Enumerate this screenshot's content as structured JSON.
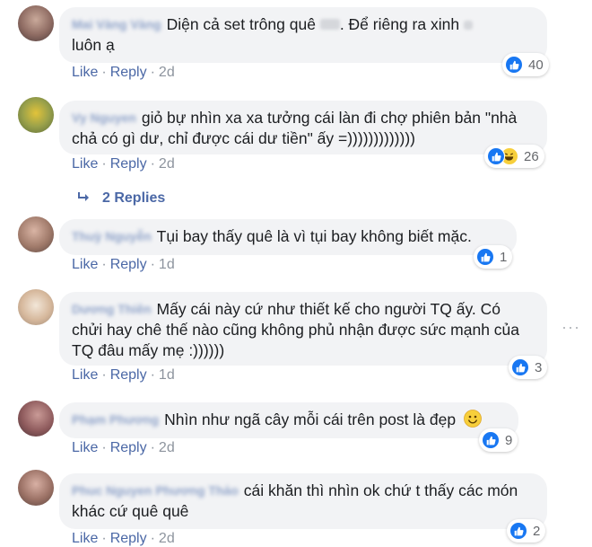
{
  "colors": {
    "accent": "#4b68a6",
    "like_blue": "#1877f2",
    "bubble_bg": "#f2f3f5"
  },
  "action_labels": {
    "like": "Like",
    "reply": "Reply",
    "separator": "·"
  },
  "comments": [
    {
      "author": "Mai Vàng Vàng",
      "text_a": "Diện cả set trông quê",
      "text_b": ". Để riêng ra xinh",
      "text_c": "luôn ạ",
      "time": "2d",
      "reactions": [
        "like"
      ],
      "reaction_count": "40"
    },
    {
      "author": "Vy Nguyen",
      "text": "giỏ bự nhìn xa xa tưởng cái làn đi chợ phiên bản \"nhà chả có gì dư, chỉ được cái dư tiền\" ấy =)))))))))))))",
      "time": "2d",
      "reactions": [
        "like",
        "haha"
      ],
      "reaction_count": "26",
      "replies_label": "2 Replies"
    },
    {
      "author": "Thuỳ Nguyễn",
      "text": "Tụi bay thấy quê là vì tụi bay không biết mặc.",
      "time": "1d",
      "reactions": [
        "like"
      ],
      "reaction_count": "1"
    },
    {
      "author": "Dương Thiên",
      "text": "Mấy cái này cứ như thiết kế cho người TQ ấy. Có chửi hay chê thế nào cũng không phủ nhận được sức mạnh của TQ đâu mấy mẹ :))))))",
      "time": "1d",
      "reactions": [
        "like"
      ],
      "reaction_count": "3",
      "more_icon": "···"
    },
    {
      "author": "Phạm Phương",
      "text": "Nhìn như ngã cây mỗi cái trên post là đẹp",
      "time": "2d",
      "reactions": [
        "like"
      ],
      "reaction_count": "9"
    },
    {
      "author": "Phuc Nguyen Phương Thảo",
      "text": "cái khăn thì nhìn ok chứ t thấy các món khác cứ quê quê",
      "time": "2d",
      "reactions": [
        "like"
      ],
      "reaction_count": "2"
    }
  ]
}
